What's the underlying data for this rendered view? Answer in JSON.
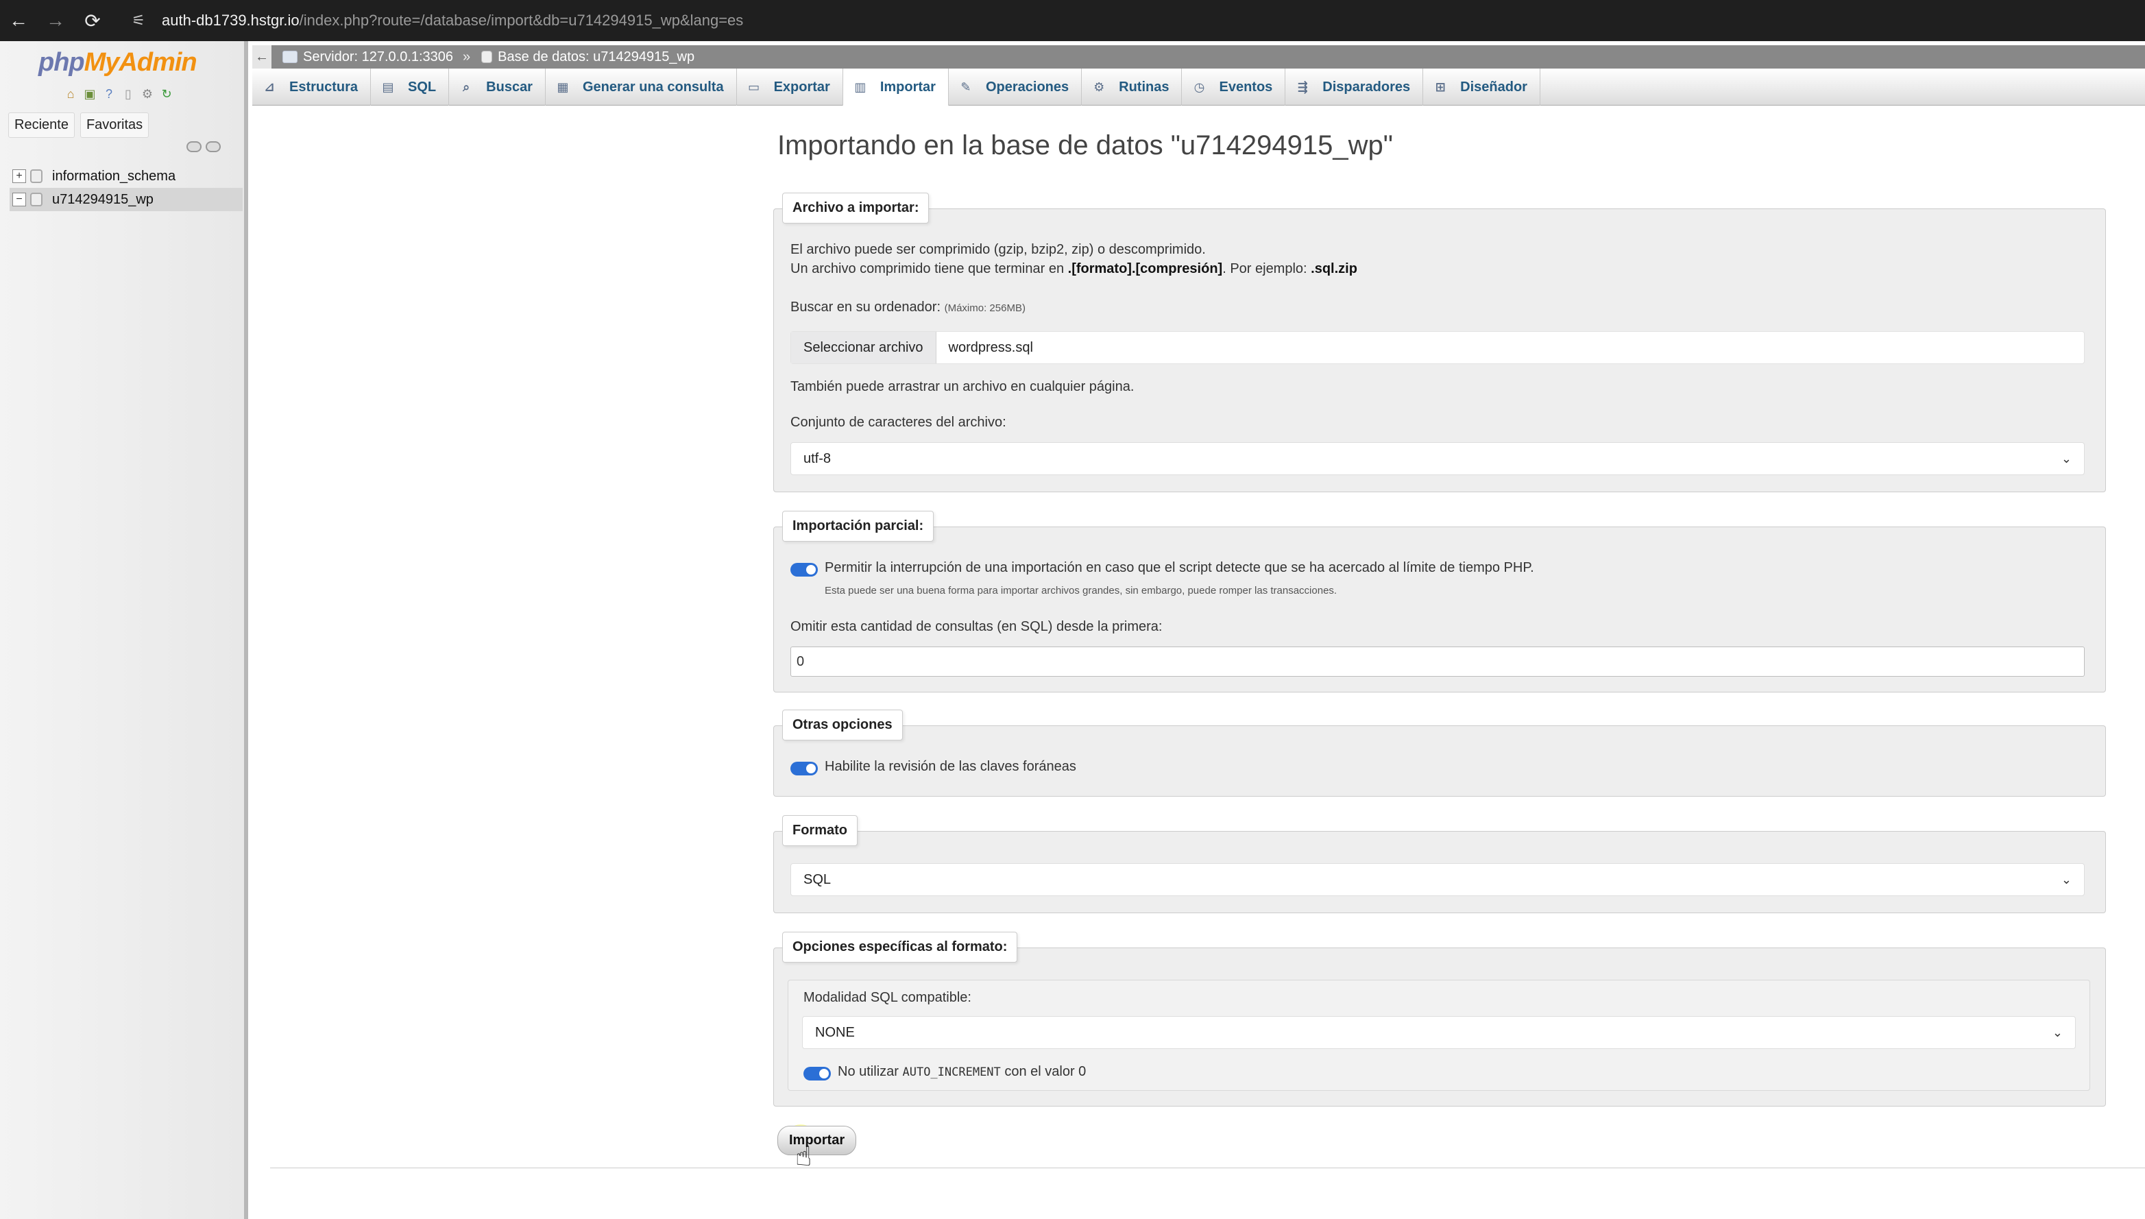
{
  "browser": {
    "back_icon": "back-arrow-icon",
    "forward_icon": "forward-arrow-icon",
    "reload_icon": "reload-icon",
    "url_host": "auth-db1739.hstgr.io",
    "url_path": "/index.php?route=/database/import&db=u714294915_wp&lang=es"
  },
  "sidebar": {
    "logo_php": "php",
    "logo_my": "MyAdmin",
    "tabs": [
      "Reciente",
      "Favoritas"
    ],
    "databases": [
      {
        "name": "information_schema",
        "toggle": "+",
        "active": false
      },
      {
        "name": "u714294915_wp",
        "toggle": "−",
        "active": true
      }
    ]
  },
  "breadcrumb": {
    "back": "←",
    "server": "Servidor: 127.0.0.1:3306",
    "separator": "»",
    "database": "Base de datos: u714294915_wp"
  },
  "tabs": [
    {
      "label": "Estructura",
      "icon": "structure-icon",
      "glyph": "⊿"
    },
    {
      "label": "SQL",
      "icon": "sql-icon",
      "glyph": "▤"
    },
    {
      "label": "Buscar",
      "icon": "search-icon",
      "glyph": "⌕"
    },
    {
      "label": "Generar una consulta",
      "icon": "query-icon",
      "glyph": "▦"
    },
    {
      "label": "Exportar",
      "icon": "export-icon",
      "glyph": "▭"
    },
    {
      "label": "Importar",
      "icon": "import-icon",
      "glyph": "▥",
      "active": true
    },
    {
      "label": "Operaciones",
      "icon": "operations-icon",
      "glyph": "✎"
    },
    {
      "label": "Rutinas",
      "icon": "routines-icon",
      "glyph": "⚙"
    },
    {
      "label": "Eventos",
      "icon": "events-icon",
      "glyph": "◷"
    },
    {
      "label": "Disparadores",
      "icon": "triggers-icon",
      "glyph": "⇶"
    },
    {
      "label": "Diseñador",
      "icon": "designer-icon",
      "glyph": "⊞"
    }
  ],
  "main": {
    "title": "Importando en la base de datos \"u714294915_wp\"",
    "file_section": {
      "legend": "Archivo a importar:",
      "line1": "El archivo puede ser comprimido (gzip, bzip2, zip) o descomprimido.",
      "line2_prefix": "Un archivo comprimido tiene que terminar en ",
      "line2_bold": ".[formato].[compresión]",
      "line2_mid": ". Por ejemplo: ",
      "line2_example": ".sql.zip",
      "browse_label": "Buscar en su ordenador:",
      "browse_max": "(Máximo: 256MB)",
      "file_button": "Seleccionar archivo",
      "file_name": "wordpress.sql",
      "drag_hint": "También puede arrastrar un archivo en cualquier página.",
      "charset_label": "Conjunto de caracteres del archivo:",
      "charset_value": "utf-8"
    },
    "partial_section": {
      "legend": "Importación parcial:",
      "allow_interrupt": "Permitir la interrupción de una importación en caso que el script detecte que se ha acercado al límite de tiempo PHP.",
      "allow_interrupt_hint": "Esta puede ser una buena forma para importar archivos grandes, sin embargo, puede romper las transacciones.",
      "skip_label": "Omitir esta cantidad de consultas (en SQL) desde la primera:",
      "skip_value": "0"
    },
    "other_section": {
      "legend": "Otras opciones",
      "foreign_keys": "Habilite la revisión de las claves foráneas"
    },
    "format_section": {
      "legend": "Formato",
      "format_value": "SQL"
    },
    "format_options": {
      "legend": "Opciones específicas al formato:",
      "compat_label": "Modalidad SQL compatible:",
      "compat_value": "NONE",
      "no_auto_prefix": "No utilizar ",
      "no_auto_code": "AUTO_INCREMENT",
      "no_auto_suffix": " con el valor 0"
    },
    "submit_label": "Importar"
  },
  "colors": {
    "tab_text": "#235a81",
    "toggle_on": "#2b6fd6",
    "logo_php": "#6c78af",
    "logo_my": "#f29111"
  }
}
